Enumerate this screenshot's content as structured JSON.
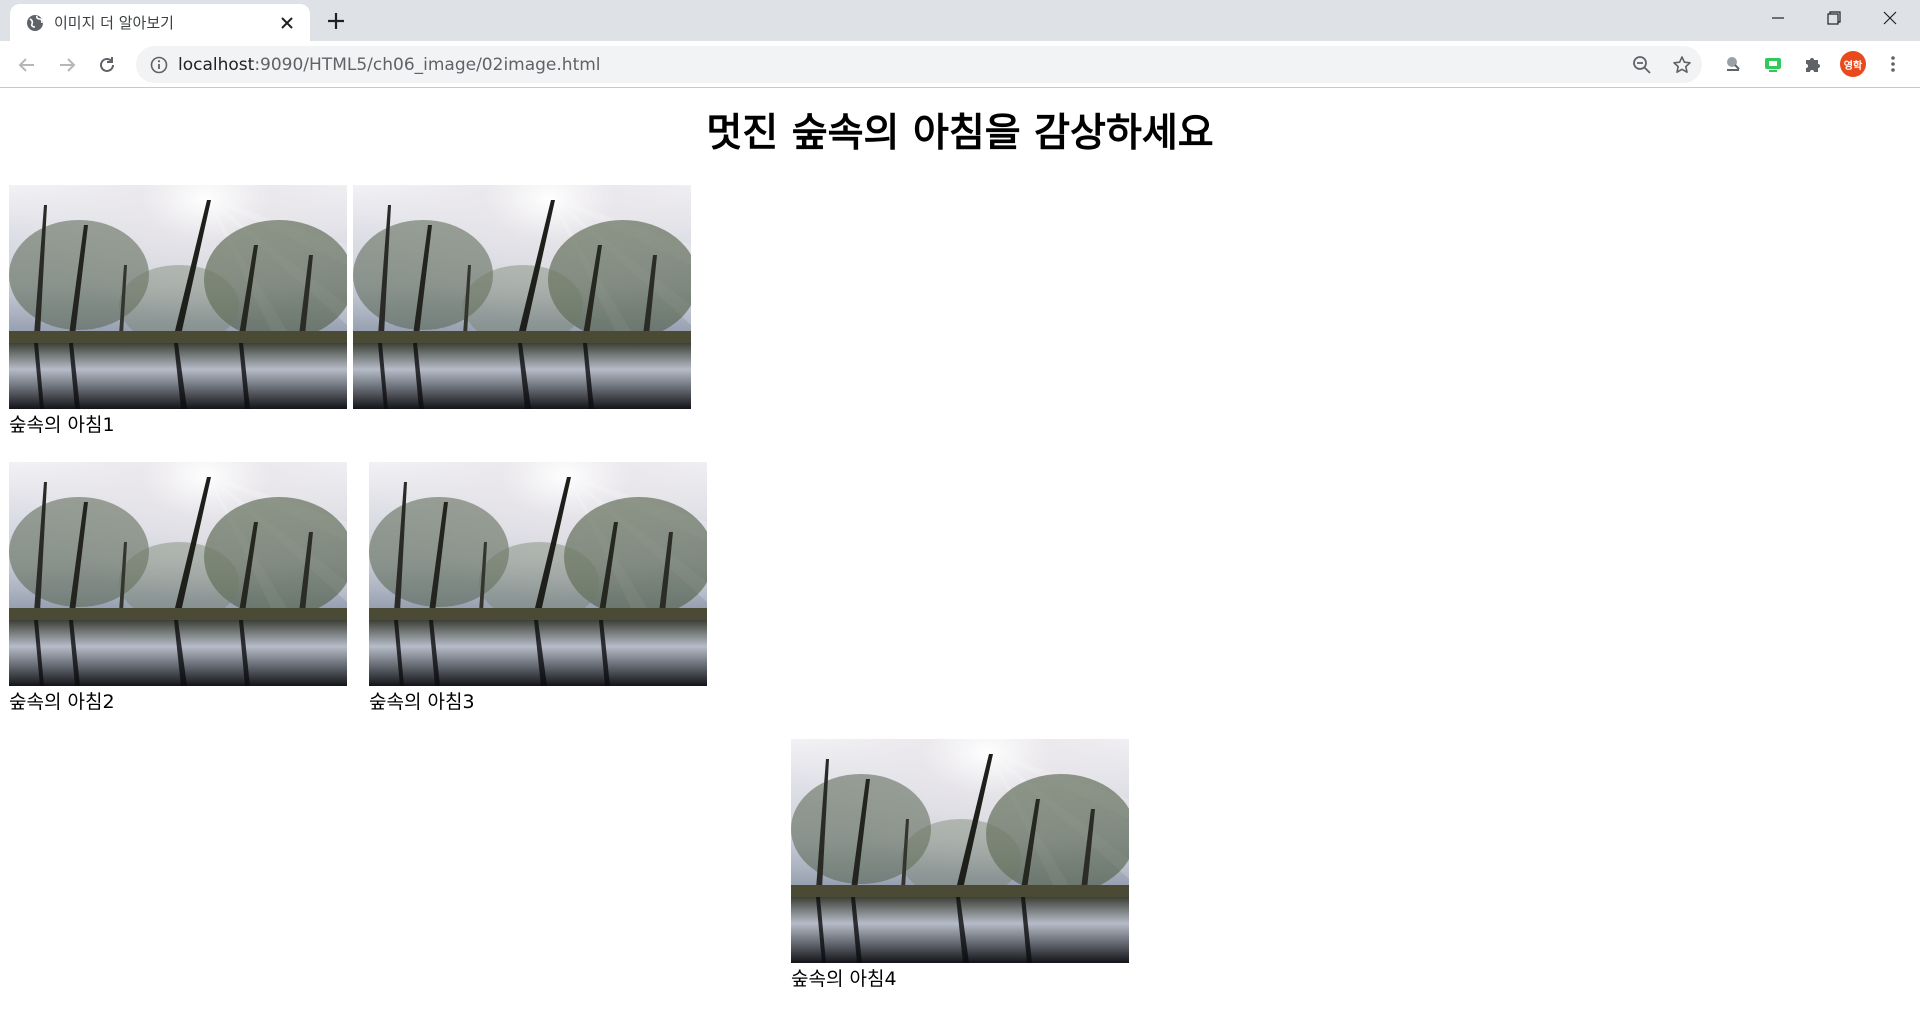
{
  "browser": {
    "tab_title": "이미지 더 알아보기",
    "url_host": "localhost",
    "url_path": ":9090/HTML5/ch06_image/02image.html",
    "profile_initials": "영학"
  },
  "page": {
    "heading": "멋진 숲속의 아침을 감상하세요",
    "captions": {
      "first": "숲속의 아침1",
      "second": "숲속의 아침2",
      "third": "숲속의 아침3",
      "fourth": "숲속의 아침4"
    }
  },
  "colors": {
    "tabbar_bg": "#dee1e6",
    "omnibox_bg": "#f1f3f4",
    "profile_bg": "#e8491d"
  },
  "icons": [
    "globe-icon",
    "close-icon",
    "plus-icon",
    "minimize-icon",
    "restore-icon",
    "window-close-icon",
    "back-arrow-icon",
    "forward-arrow-icon",
    "reload-icon",
    "info-icon",
    "zoom-out-icon",
    "star-icon",
    "extension-icon",
    "puzzle-icon",
    "more-vert-icon"
  ]
}
